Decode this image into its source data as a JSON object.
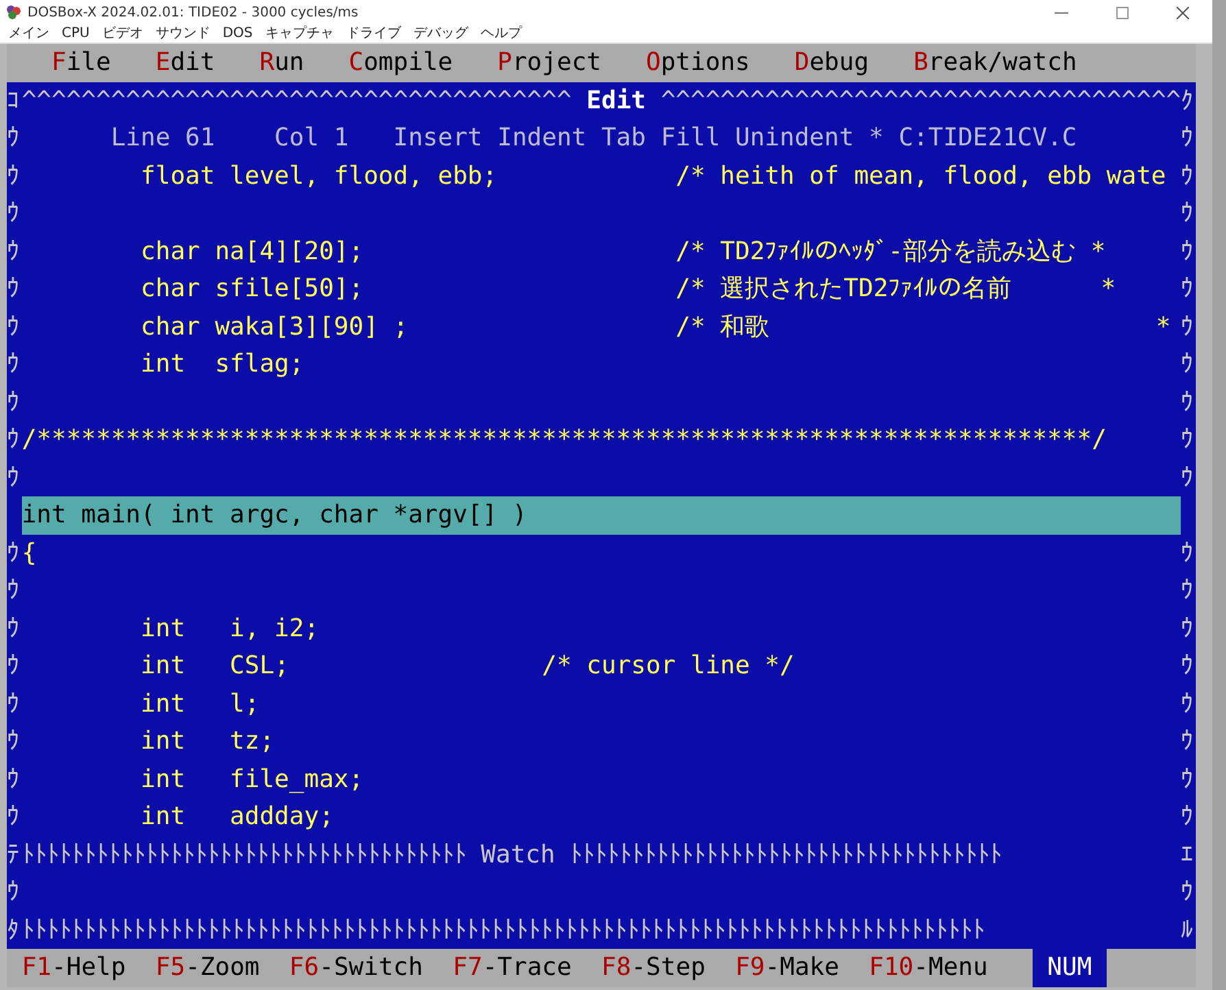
{
  "window": {
    "title": "DOSBox-X 2024.02.01: TIDE02 - 3000 cycles/ms"
  },
  "host_menu": [
    "メイン",
    "CPU",
    "ビデオ",
    "サウンド",
    "DOS",
    "キャプチャ",
    "ドライブ",
    "デバッグ",
    "ヘルプ"
  ],
  "menu_bar": [
    {
      "key": "F",
      "rest": "ile"
    },
    {
      "key": "E",
      "rest": "dit"
    },
    {
      "key": "R",
      "rest": "un"
    },
    {
      "key": "C",
      "rest": "ompile"
    },
    {
      "key": "P",
      "rest": "roject"
    },
    {
      "key": "O",
      "rest": "ptions"
    },
    {
      "key": "D",
      "rest": "ebug"
    },
    {
      "key": "B",
      "rest": "reak/watch"
    }
  ],
  "edit_frame": {
    "left": "ｺ",
    "fill_before": "^^^^^^^^^^^^^^^^^^^^^^^^^^^^^^^^^^^^^",
    "title": "Edit",
    "fill_after": "^^^^^^^^^^^^^^^^^^^^^^^^^^^^^^^^^^^",
    "right": "ｸ"
  },
  "status_line": {
    "left": "ｳ",
    "text": "      Line 61    Col 1   Insert Indent Tab Fill Unindent * C:TIDE21CV.C",
    "right": "ｳ"
  },
  "code_lines": [
    {
      "left": "ｳ",
      "text": "        float level, flood, ebb;            /* heith of mean, flood, ebb wate",
      "right": "ｳ",
      "selected": false
    },
    {
      "left": "ｳ",
      "right": "ｳ",
      "selected": false
    },
    {
      "left": "ｳ",
      "text": "        char na[4][20];                     /* TD2ﾌｧｲﾙのﾍｯﾀﾞ-部分を読み込む *",
      "right": "ｳ",
      "selected": false
    },
    {
      "left": "ｳ",
      "text": "        char sfile[50];                     /* 選択されたTD2ﾌｧｲﾙの名前      *",
      "right": "ｳ",
      "selected": false
    },
    {
      "left": "ｳ",
      "text": "        char waka[3][90] ;                  /* 和歌                          *",
      "right": "ｳ",
      "selected": false
    },
    {
      "left": "ｳ",
      "text": "        int  sflag;",
      "right": "ｳ",
      "selected": false
    },
    {
      "left": "ｳ",
      "right": "ｳ",
      "selected": false
    },
    {
      "left": "ｳ",
      "text": "/***********************************************************************/",
      "right": "ｳ",
      "selected": false
    },
    {
      "left": "ｳ",
      "right": "ｳ",
      "selected": false
    },
    {
      "text": "int main( int argc, char *argv[] )",
      "selected": true
    },
    {
      "left": "ｳ",
      "text": "{",
      "right": "ｳ",
      "selected": false
    },
    {
      "left": "ｳ",
      "right": "ｳ",
      "selected": false
    },
    {
      "left": "ｳ",
      "text": "        int   i, i2;",
      "right": "ｳ",
      "selected": false
    },
    {
      "left": "ｳ",
      "text": "        int   CSL;                 /* cursor line */",
      "right": "ｳ",
      "selected": false
    },
    {
      "left": "ｳ",
      "text": "        int   l;",
      "right": "ｳ",
      "selected": false
    },
    {
      "left": "ｳ",
      "text": "        int   tz;",
      "right": "ｳ",
      "selected": false
    },
    {
      "left": "ｳ",
      "text": "        int   file_max;",
      "right": "ｳ",
      "selected": false
    },
    {
      "left": "ｳ",
      "text": "        int   addday;",
      "right": "ｳ",
      "selected": false
    }
  ],
  "watch_frame": {
    "left": "ﾃ",
    "fill_before": "ﾄﾄﾄﾄﾄﾄﾄﾄﾄﾄﾄﾄﾄﾄﾄﾄﾄﾄﾄﾄﾄﾄﾄﾄﾄﾄﾄﾄﾄﾄﾄﾄﾄﾄﾄﾄ",
    "title": "Watch",
    "fill_after": "ﾄﾄﾄﾄﾄﾄﾄﾄﾄﾄﾄﾄﾄﾄﾄﾄﾄﾄﾄﾄﾄﾄﾄﾄﾄﾄﾄﾄﾄﾄﾄﾄﾄﾄﾄ",
    "right": "ｴ"
  },
  "watch_lines": [
    {
      "left": "ｳ",
      "right": "ｳ"
    }
  ],
  "bottom_frame": {
    "left": "ﾀ",
    "fill": "ﾄﾄﾄﾄﾄﾄﾄﾄﾄﾄﾄﾄﾄﾄﾄﾄﾄﾄﾄﾄﾄﾄﾄﾄﾄﾄﾄﾄﾄﾄﾄﾄﾄﾄﾄﾄﾄﾄﾄﾄﾄﾄﾄﾄﾄﾄﾄﾄﾄﾄﾄﾄﾄﾄﾄﾄﾄﾄﾄﾄﾄﾄﾄﾄﾄﾄﾄﾄﾄﾄﾄﾄﾄﾄﾄﾄﾄﾄ",
    "right": "ﾙ"
  },
  "function_keys": [
    {
      "key": "F1",
      "label": "-Help"
    },
    {
      "key": "F5",
      "label": "-Zoom"
    },
    {
      "key": "F6",
      "label": "-Switch"
    },
    {
      "key": "F7",
      "label": "-Trace"
    },
    {
      "key": "F8",
      "label": "-Step"
    },
    {
      "key": "F9",
      "label": "-Make"
    },
    {
      "key": "F10",
      "label": "-Menu"
    }
  ],
  "num_indicator": {
    "text": "NUM",
    "on": true
  }
}
